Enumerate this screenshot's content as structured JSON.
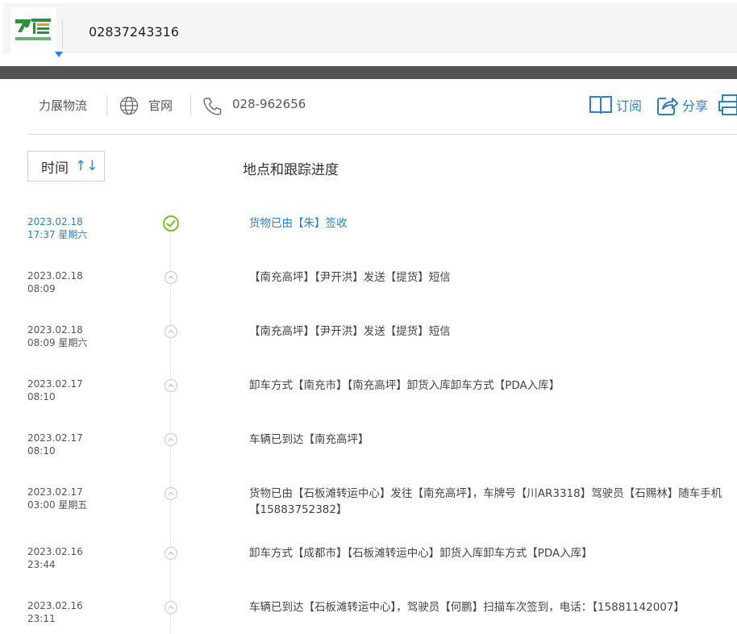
{
  "header": {
    "tracking_number": "02837243316"
  },
  "carrier": {
    "name": "力展物流",
    "website_label": "官网",
    "phone": "028-962656"
  },
  "actions": {
    "subscribe": "订阅",
    "share": "分享"
  },
  "table": {
    "time_header": "时间",
    "sort_icon": "↑↓",
    "progress_header": "地点和跟踪进度"
  },
  "events": [
    {
      "date": "2023.02.18",
      "time": "17:37 星期六",
      "text": "货物已由【朱】签收",
      "status": "delivered"
    },
    {
      "date": "2023.02.18",
      "time": "08:09",
      "text": "【南充高坪】【尹开洪】发送【提货】短信",
      "status": "in-transit"
    },
    {
      "date": "2023.02.18",
      "time": "08:09 星期六",
      "text": "【南充高坪】【尹开洪】发送【提货】短信",
      "status": "in-transit"
    },
    {
      "date": "2023.02.17",
      "time": "08:10",
      "text": "卸车方式【南充市】【南充高坪】卸货入库卸车方式【PDA入库】",
      "status": "in-transit"
    },
    {
      "date": "2023.02.17",
      "time": "08:10",
      "text": "车辆已到达【南充高坪】",
      "status": "in-transit"
    },
    {
      "date": "2023.02.17",
      "time": "03:00 星期五",
      "text": "货物已由【石板滩转运中心】发往【南充高坪】，车牌号【川AR3318】驾驶员【石赐林】随车手机【15883752382】",
      "status": "in-transit"
    },
    {
      "date": "2023.02.16",
      "time": "23:44",
      "text": "卸车方式【成都市】【石板滩转运中心】卸货入库卸车方式【PDA入库】",
      "status": "in-transit"
    },
    {
      "date": "2023.02.16",
      "time": "23:11",
      "text": "车辆已到达【石板滩转运中心】，驾驶员【何鹏】扫描车次签到，电话：【15881142007】",
      "status": "in-transit"
    }
  ],
  "colors": {
    "accent": "#2a7fd3",
    "delivered": "#7cc12a",
    "dark_band": "#545454"
  }
}
